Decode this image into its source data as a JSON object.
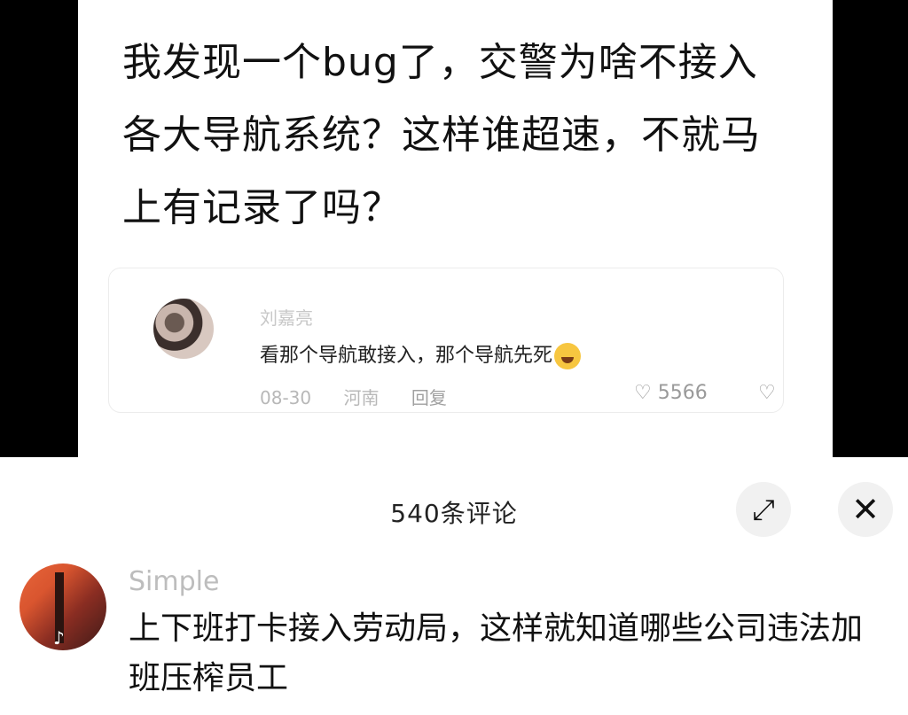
{
  "post": {
    "text": "我发现一个bug了，交警为啥不接入各大导航系统？这样谁超速，不就马上有记录了吗？"
  },
  "quoted_comment": {
    "author": "刘嘉亮",
    "text": "看那个导航敢接入，那个导航先死",
    "emoji_icon": "rolling-laughing-icon",
    "date": "08-30",
    "location": "河南",
    "reply_label": "回复",
    "likes": "5566",
    "like_icon": "heart-icon",
    "dislike_icon": "broken-heart-icon"
  },
  "sheet": {
    "title": "540条评论",
    "expand_icon": "expand-icon",
    "close_icon": "close-icon"
  },
  "comment": {
    "author": "Simple",
    "text": "上下班打卡接入劳动局，这样就知道哪些公司违法加班压榨员工",
    "badge_icon": "tiktok-icon"
  }
}
